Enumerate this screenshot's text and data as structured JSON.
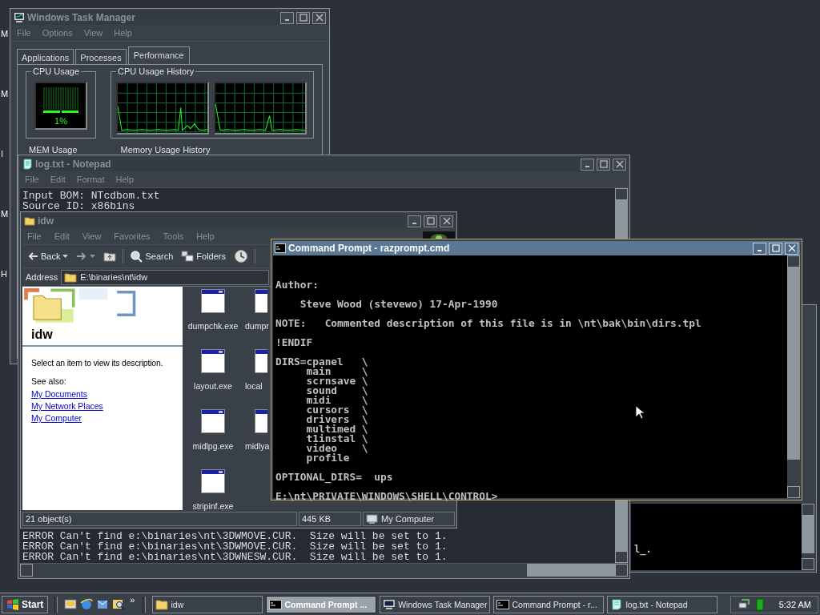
{
  "desktop_labels": [
    "M",
    "M",
    "I",
    "M",
    "H"
  ],
  "task_manager": {
    "title": "Windows Task Manager",
    "active": false,
    "menu": [
      "File",
      "Options",
      "View",
      "Help"
    ],
    "tabs": [
      {
        "label": "Applications",
        "selected": false
      },
      {
        "label": "Processes",
        "selected": false
      },
      {
        "label": "Performance",
        "selected": true
      }
    ],
    "cpu_usage": {
      "title": "CPU Usage",
      "reading": "1%"
    },
    "cpu_history": {
      "title": "CPU Usage History"
    },
    "mem_usage": {
      "title": "MEM Usage"
    },
    "mem_history": {
      "title": "Memory Usage History"
    }
  },
  "notepad": {
    "title": "log.txt - Notepad",
    "active": false,
    "menu": [
      "File",
      "Edit",
      "Format",
      "Help"
    ],
    "top_lines": [
      "Input BOM: NTcdbom.txt",
      "Source ID: x86bins"
    ],
    "bottom_lines": [
      "ERROR Can't find e:\\binaries\\nt\\3DWMOVE.CUR.  Size will be set to 1.",
      "ERROR Can't find e:\\binaries\\nt\\3DWMOVE.CUR.  Size will be set to 1.",
      "ERROR Can't find e:\\binaries\\nt\\3DWNESW.CUR.  Size will be set to 1."
    ]
  },
  "explorer": {
    "title": "idw",
    "active": false,
    "menu": [
      "File",
      "Edit",
      "View",
      "Favorites",
      "Tools",
      "Help"
    ],
    "toolbar": {
      "back": "Back",
      "forward": {
        "disabled": true
      },
      "search": "Search",
      "folders": "Folders"
    },
    "address": {
      "label": "Address",
      "value": "E:\\binaries\\nt\\idw"
    },
    "folder_name": "idw",
    "description": "Select an item to view its description.",
    "see_also": "See also:",
    "links": [
      "My Documents",
      "My Network Places",
      "My Computer"
    ],
    "files": [
      {
        "name": "dumpchk.exe"
      },
      {
        "name": "dumpr"
      },
      {
        "name": "layout.exe"
      },
      {
        "name": "local"
      },
      {
        "name": "midlpg.exe"
      },
      {
        "name": "midlya"
      },
      {
        "name": "stripinf.exe"
      }
    ],
    "status": [
      "21 object(s)",
      "445 KB",
      "My Computer"
    ]
  },
  "background_console": {
    "lines": [
      "l_."
    ]
  },
  "command_prompt": {
    "title": "Command Prompt - razprompt.cmd",
    "active": true,
    "blocks": [
      [
        "Author:"
      ],
      [
        "    Steve Wood (stevewo) 17-Apr-1990"
      ],
      [
        "NOTE:   Commented description of this file is in \\nt\\bak\\bin\\dirs.tpl"
      ],
      [
        "!ENDIF"
      ],
      [
        "DIRS=cpanel   \\",
        "     main     \\",
        "     scrnsave \\",
        "     sound    \\",
        "     midi     \\",
        "     cursors  \\",
        "     drivers  \\",
        "     multimed \\",
        "     t1instal \\",
        "     video    \\",
        "     profile"
      ],
      [
        "OPTIONAL_DIRS=  ups"
      ],
      [
        "E:\\nt\\PRIVATE\\WINDOWS\\SHELL\\CONTROL>"
      ]
    ]
  },
  "taskbar": {
    "start": "Start",
    "more": "»",
    "buttons": [
      {
        "label": "idw",
        "kind": "folder",
        "selected": false
      },
      {
        "label": "Command Prompt ...",
        "kind": "console",
        "selected": true
      },
      {
        "label": "Windows Task Manager",
        "kind": "monitor",
        "selected": false
      },
      {
        "label": "Command Prompt - r...",
        "kind": "console",
        "selected": false
      },
      {
        "label": "log.txt - Notepad",
        "kind": "notepad",
        "selected": false
      }
    ],
    "clock": "5:32 AM"
  }
}
